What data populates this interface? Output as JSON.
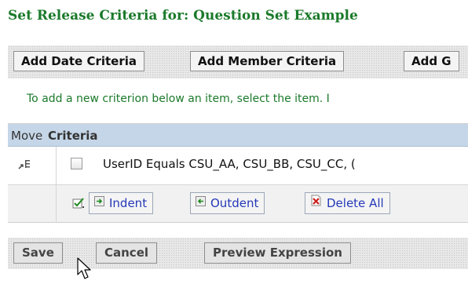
{
  "page": {
    "title": "Set Release Criteria for: Question Set Example"
  },
  "toolbar": {
    "add_date_label": "Add Date Criteria",
    "add_member_label": "Add Member Criteria",
    "add_group_label": "Add G"
  },
  "hint": "To add a new criterion below an item, select the item. I",
  "table": {
    "header_move": "Move",
    "header_criteria": "Criteria",
    "rows": [
      {
        "text": "UserID Equals CSU_AA, CSU_BB, CSU_CC, ("
      }
    ],
    "actions": {
      "indent_label": "Indent",
      "outdent_label": "Outdent",
      "delete_all_label": "Delete All"
    }
  },
  "buttons": {
    "save_label": "Save",
    "cancel_label": "Cancel",
    "preview_label": "Preview Expression"
  },
  "colors": {
    "title": "#1b7a2b",
    "header_bg": "#c5d6e8",
    "link_blue": "#2538b8"
  }
}
